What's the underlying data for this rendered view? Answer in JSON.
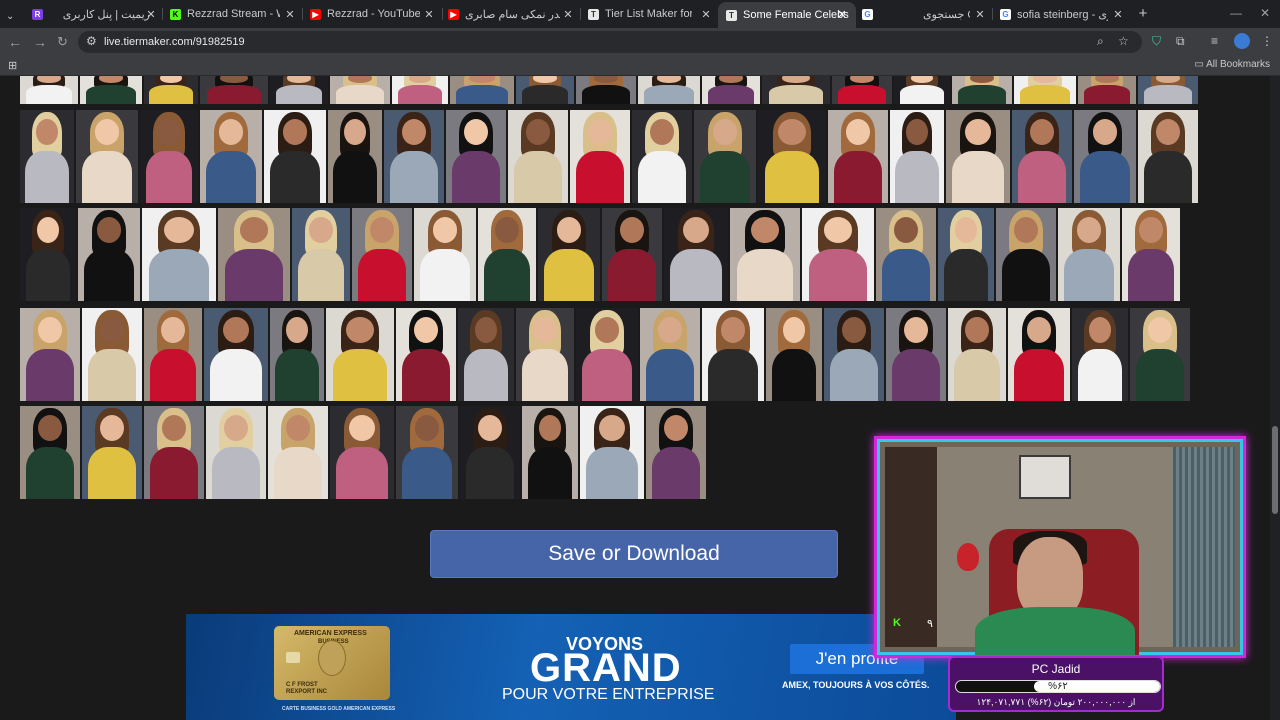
{
  "browser": {
    "tabs": [
      {
        "title": "ریمیت | پنل کاربری",
        "favicon": "remit-icon",
        "color": "#7b3fe4",
        "letter": "R"
      },
      {
        "title": "Rezzrad Stream - Watch L",
        "favicon": "kick-icon",
        "color": "#53fc18",
        "letter": "K"
      },
      {
        "title": "Rezzrad - YouTube",
        "favicon": "youtube-icon",
        "color": "#ff0000",
        "letter": "▶"
      },
      {
        "title": "تو چقدر نمکی سام صابری",
        "favicon": "youtube-icon",
        "color": "#ff0000",
        "letter": "▶"
      },
      {
        "title": "Tier List Maker for Everyth",
        "favicon": "tiermaker-icon",
        "color": "#e8e8e8",
        "letter": "T"
      },
      {
        "title": "Some Female Celebs",
        "favicon": "tiermaker-icon",
        "color": "#e8e8e8",
        "letter": "T",
        "active": true
      },
      {
        "title": "جستجوی Google",
        "favicon": "google-icon",
        "color": "#ffffff",
        "letter": "G"
      },
      {
        "title": "sofia steinberg - جستجوی",
        "favicon": "google-icon",
        "color": "#ffffff",
        "letter": "G"
      }
    ],
    "url": "live.tiermaker.com/91982519",
    "bookmarks_label": "All Bookmarks"
  },
  "page": {
    "save_button_label": "Save or Download"
  },
  "ad": {
    "card_brand": "AMERICAN EXPRESS",
    "card_sub": "BUSINESS",
    "card_holder": "C F FROST",
    "card_company": "REXPORT INC",
    "card_footer": "CARTE BUSINESS GOLD AMERICAN EXPRESS",
    "headline_small": "VOYONS",
    "headline_big": "GRAND",
    "subline": "POUR VOTRE ENTREPRISE",
    "cta_label": "J'en profite",
    "tagline": "AMEX, TOUJOURS À VOS CÔTÉS."
  },
  "stream_overlay": {
    "kick_label": "K",
    "viewer_count": "۹",
    "goal_title": "PC Jadid",
    "goal_percent_text": "%۶۲",
    "goal_fraction": 0.62,
    "goal_sub": "۱۲۴,۰۷۱,۷۷۱ از ۲۰۰,۰۰۰,۰۰۰ تومان (۶۲%)"
  },
  "colors": {
    "accent_button": "#4664a8",
    "overlay_border": "#d228d8",
    "overlay_inner": "#36c7e6"
  }
}
